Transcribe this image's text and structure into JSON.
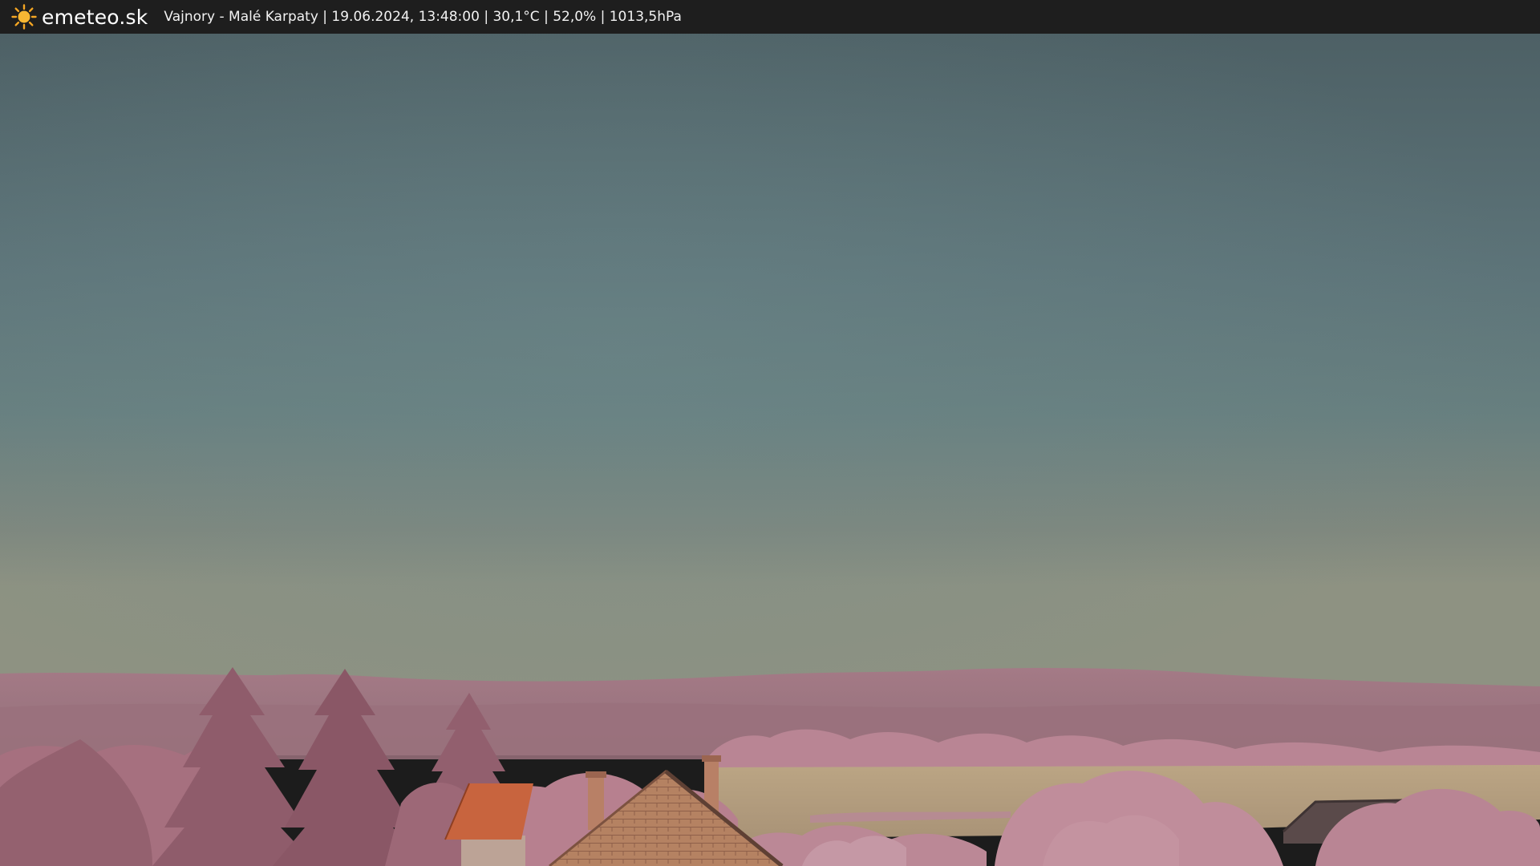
{
  "header": {
    "brand": "emeteo.sk",
    "logo_icon": "sun-icon",
    "caption": "Vajnory - Malé Karpaty | 19.06.2024, 13:48:00 | 30,1°C | 52,0% | 1013,5hPa"
  },
  "colors": {
    "bar": "#1e1e1e",
    "sun": "#f5a623",
    "sky_top": "#4c5f64",
    "sky_mid": "#637c7e",
    "sky_horizon": "#8f9481",
    "hills": "#a07682",
    "foliage": "#bd8a98",
    "field": "#b6a083",
    "roof": "#c8643e"
  }
}
